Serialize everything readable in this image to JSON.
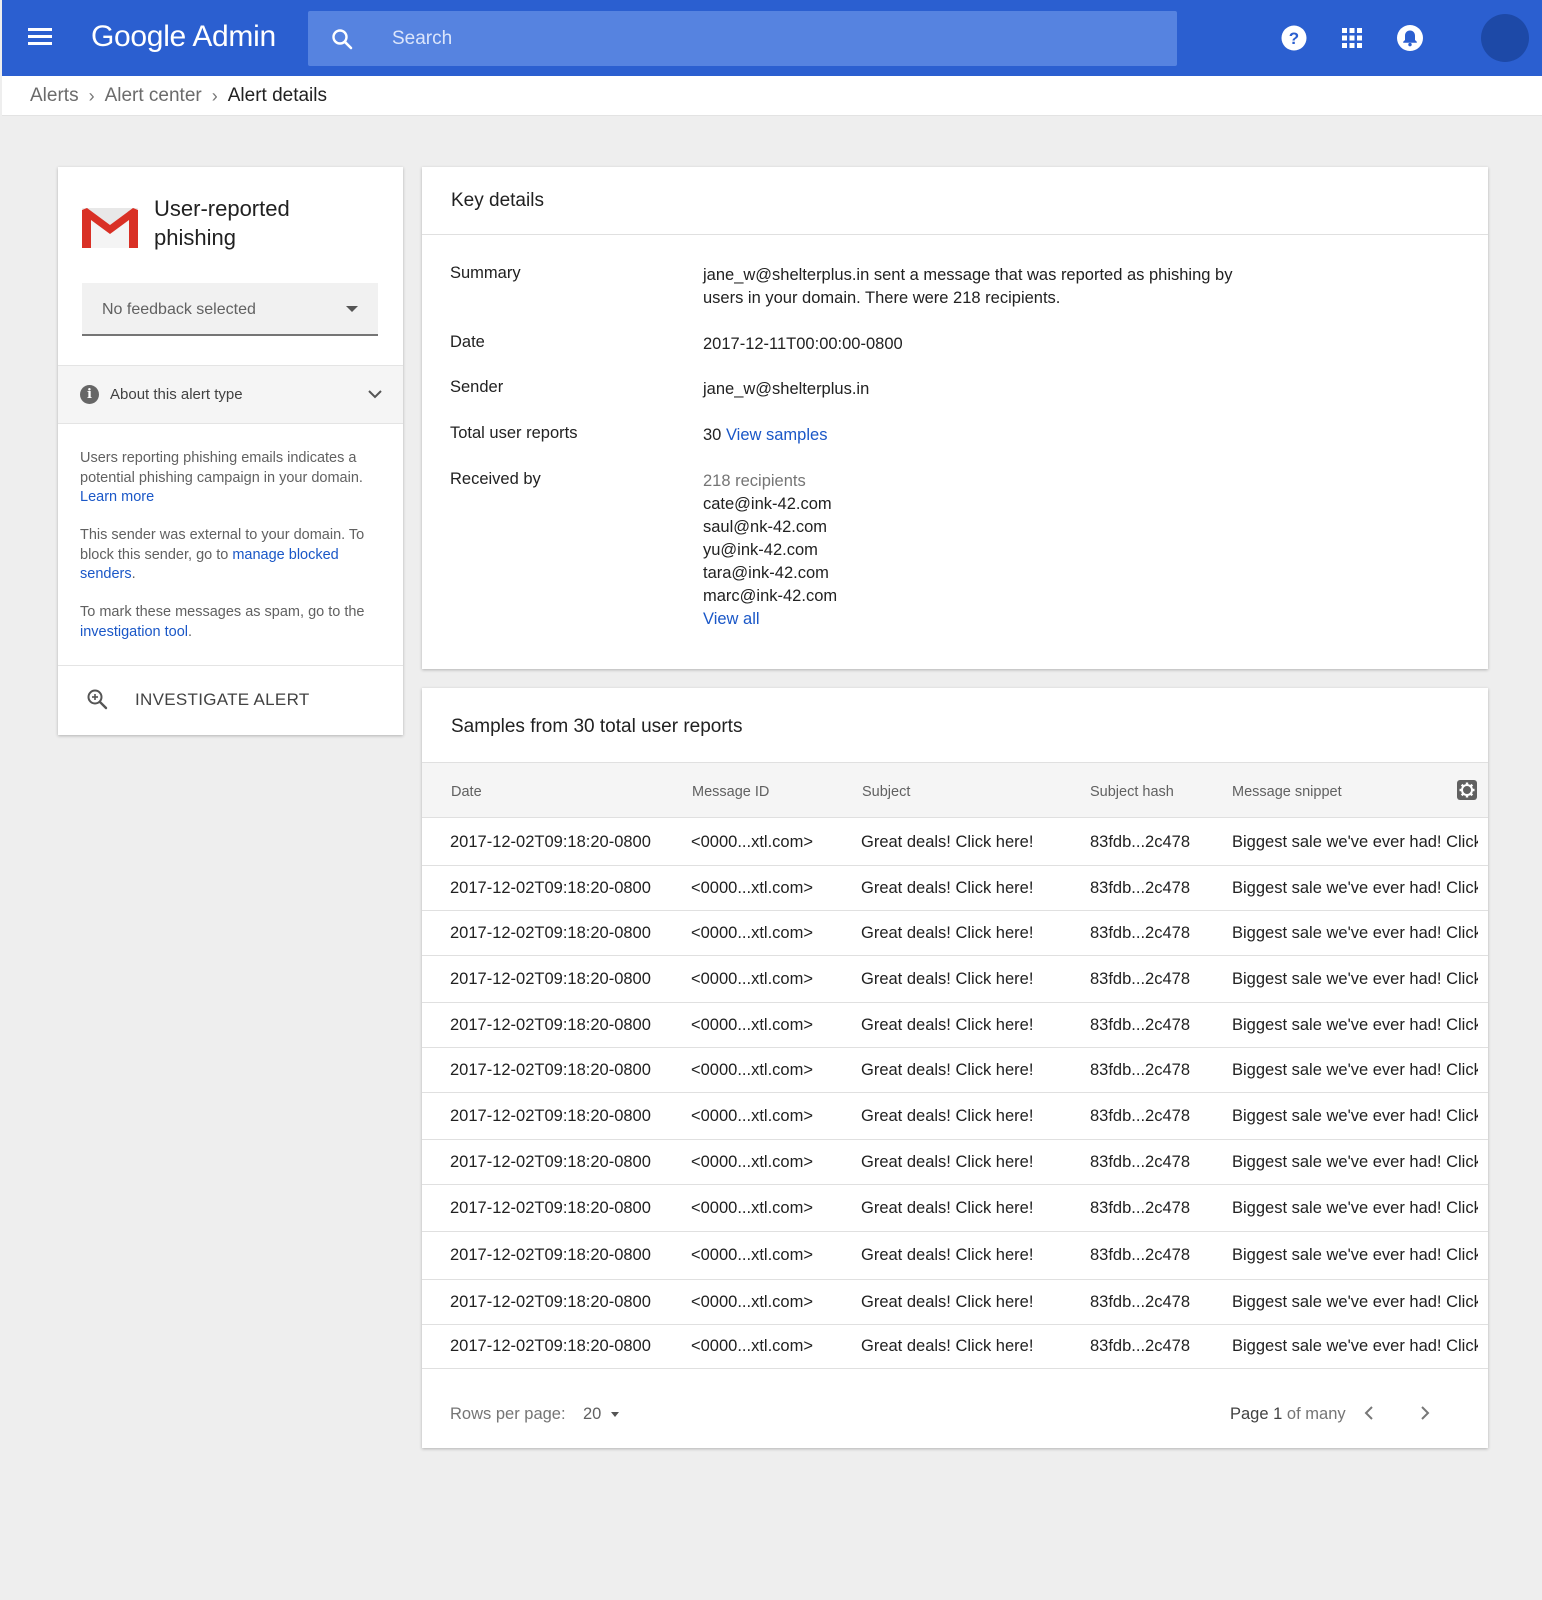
{
  "app": {
    "brand": "Google Admin",
    "search_placeholder": "Search",
    "colors": {
      "topbar": "#2b5fd0",
      "search": "#5683e0",
      "link": "#1a57c7",
      "gmail_red": "#d93025"
    },
    "icons": [
      "menu-icon",
      "search-icon",
      "help-icon",
      "apps-grid-icon",
      "notifications-bell-icon",
      "avatar"
    ]
  },
  "breadcrumb": {
    "items": [
      "Alerts",
      "Alert center"
    ],
    "current": "Alert details"
  },
  "alert_card": {
    "title": "User-reported phishing",
    "feedback_value": "No feedback selected",
    "about_label": "About this alert type",
    "desc1": "Users reporting phishing emails indicates a potential phishing campaign in your domain.",
    "desc1_link": "Learn more",
    "desc2_pre": "This sender was external to your domain. To block this sender, go to ",
    "desc2_link": "manage blocked senders",
    "desc2_post": ".",
    "desc3_pre": "To mark these messages as spam, go to the ",
    "desc3_link": "investigation tool",
    "desc3_post": ".",
    "investigate_label": "INVESTIGATE ALERT"
  },
  "key_details": {
    "title": "Key details",
    "summary_label": "Summary",
    "summary_value": "jane_w@shelterplus.in sent a message that was reported as phishing by users in your domain. There were 218 recipients.",
    "date_label": "Date",
    "date_value": "2017-12-11T00:00:00-0800",
    "sender_label": "Sender",
    "sender_value": "jane_w@shelterplus.in",
    "reports_label": "Total user reports",
    "reports_count": "30",
    "reports_link": "View samples",
    "received_label": "Received by",
    "recipients_count": "218 recipients",
    "recipients": [
      "cate@ink-42.com",
      "saul@nk-42.com",
      "yu@ink-42.com",
      "tara@ink-42.com",
      "marc@ink-42.com"
    ],
    "view_all": "View all"
  },
  "samples": {
    "title": "Samples from 30 total user reports",
    "columns": [
      "Date",
      "Message ID",
      "Subject",
      "Subject hash",
      "Message snippet"
    ],
    "rows": [
      [
        "2017-12-02T09:18:20-0800",
        "<0000...xtl.com>",
        "Great deals! Click here!",
        "83fdb...2c478",
        "Biggest sale we've ever had! Click"
      ],
      [
        "2017-12-02T09:18:20-0800",
        "<0000...xtl.com>",
        "Great deals! Click here!",
        "83fdb...2c478",
        "Biggest sale we've ever had! Click"
      ],
      [
        "2017-12-02T09:18:20-0800",
        "<0000...xtl.com>",
        "Great deals! Click here!",
        "83fdb...2c478",
        "Biggest sale we've ever had! Click"
      ],
      [
        "2017-12-02T09:18:20-0800",
        "<0000...xtl.com>",
        "Great deals! Click here!",
        "83fdb...2c478",
        "Biggest sale we've ever had! Click"
      ],
      [
        "2017-12-02T09:18:20-0800",
        "<0000...xtl.com>",
        "Great deals! Click here!",
        "83fdb...2c478",
        "Biggest sale we've ever had! Click"
      ],
      [
        "2017-12-02T09:18:20-0800",
        "<0000...xtl.com>",
        "Great deals! Click here!",
        "83fdb...2c478",
        "Biggest sale we've ever had! Click"
      ],
      [
        "2017-12-02T09:18:20-0800",
        "<0000...xtl.com>",
        "Great deals! Click here!",
        "83fdb...2c478",
        "Biggest sale we've ever had! Click"
      ],
      [
        "2017-12-02T09:18:20-0800",
        "<0000...xtl.com>",
        "Great deals! Click here!",
        "83fdb...2c478",
        "Biggest sale we've ever had! Click"
      ],
      [
        "2017-12-02T09:18:20-0800",
        "<0000...xtl.com>",
        "Great deals! Click here!",
        "83fdb...2c478",
        "Biggest sale we've ever had! Click"
      ],
      [
        "2017-12-02T09:18:20-0800",
        "<0000...xtl.com>",
        "Great deals! Click here!",
        "83fdb...2c478",
        "Biggest sale we've ever had! Click"
      ],
      [
        "2017-12-02T09:18:20-0800",
        "<0000...xtl.com>",
        "Great deals! Click here!",
        "83fdb...2c478",
        "Biggest sale we've ever had! Click"
      ],
      [
        "2017-12-02T09:18:20-0800",
        "<0000...xtl.com>",
        "Great deals! Click here!",
        "83fdb...2c478",
        "Biggest sale we've ever had! Click"
      ]
    ],
    "rows_per_page_label": "Rows per page:",
    "rows_per_page_value": "20",
    "page_label": "Page",
    "page_number": "1",
    "page_suffix": "of many"
  }
}
